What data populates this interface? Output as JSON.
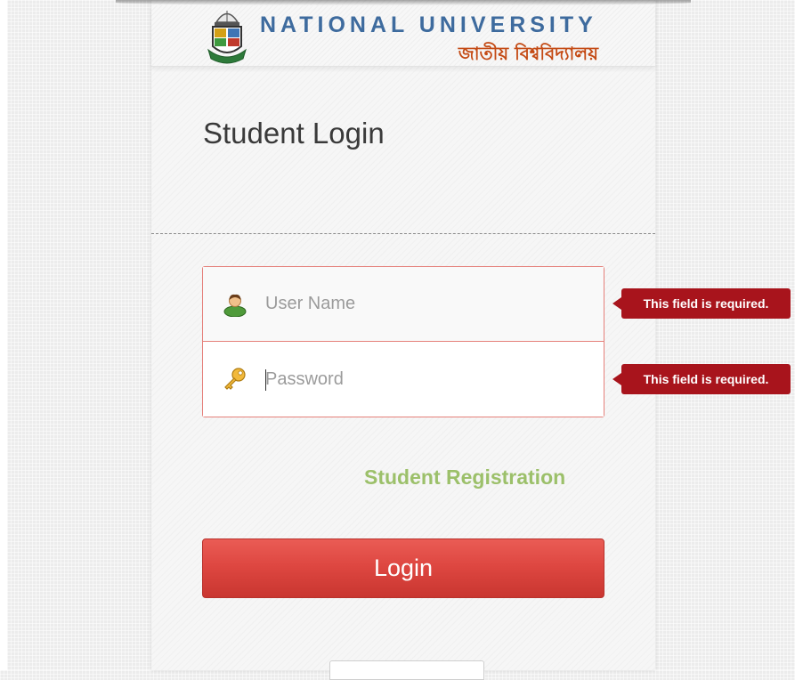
{
  "header": {
    "title_en": "NATIONAL UNIVERSITY",
    "title_bn": "জাতীয় বিশ্ববিদ্যালয়",
    "logo_icon": "university-crest-icon"
  },
  "login": {
    "page_title": "Student Login",
    "username": {
      "placeholder": "User Name",
      "value": "",
      "icon": "user-icon",
      "error": "This field is required."
    },
    "password": {
      "placeholder": "Password",
      "value": "",
      "icon": "key-icon",
      "error": "This field is required."
    },
    "register_label": "Student Registration",
    "submit_label": "Login"
  },
  "colors": {
    "brand_blue": "#3e6b9e",
    "brand_orange": "#c44a14",
    "error_red": "#a8141c",
    "button_red": "#de4741",
    "link_green": "#9cc06a"
  }
}
